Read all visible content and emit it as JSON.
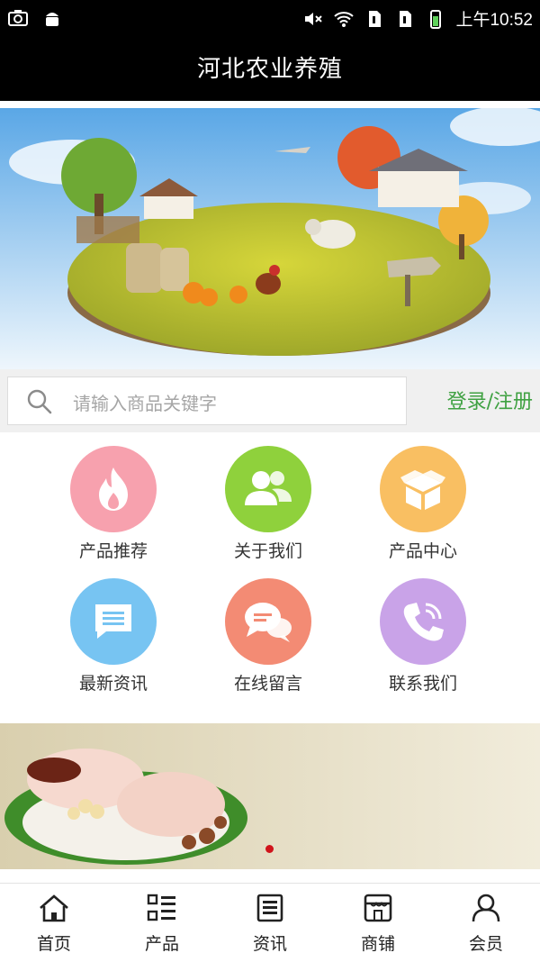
{
  "status_bar": {
    "time": "上午10:52"
  },
  "header": {
    "title": "河北农业养殖"
  },
  "search": {
    "placeholder": "请输入商品关键字",
    "login_label": "登录/注册"
  },
  "menu": [
    {
      "label": "产品推荐",
      "icon": "fire-icon",
      "color": "#f7a1ae"
    },
    {
      "label": "关于我们",
      "icon": "users-icon",
      "color": "#8fd13c"
    },
    {
      "label": "产品中心",
      "icon": "box-icon",
      "color": "#f9bf62"
    },
    {
      "label": "最新资讯",
      "icon": "document-icon",
      "color": "#77c4f2"
    },
    {
      "label": "在线留言",
      "icon": "chat-icon",
      "color": "#f38b74"
    },
    {
      "label": "联系我们",
      "icon": "phone-icon",
      "color": "#c9a3e8"
    }
  ],
  "bottom_nav": [
    {
      "label": "首页",
      "icon": "home-icon"
    },
    {
      "label": "产品",
      "icon": "list-icon"
    },
    {
      "label": "资讯",
      "icon": "news-icon"
    },
    {
      "label": "商铺",
      "icon": "store-icon"
    },
    {
      "label": "会员",
      "icon": "user-icon"
    }
  ],
  "colors": {
    "accent_green": "#3fa142",
    "carousel_dot": "#d0141b"
  }
}
